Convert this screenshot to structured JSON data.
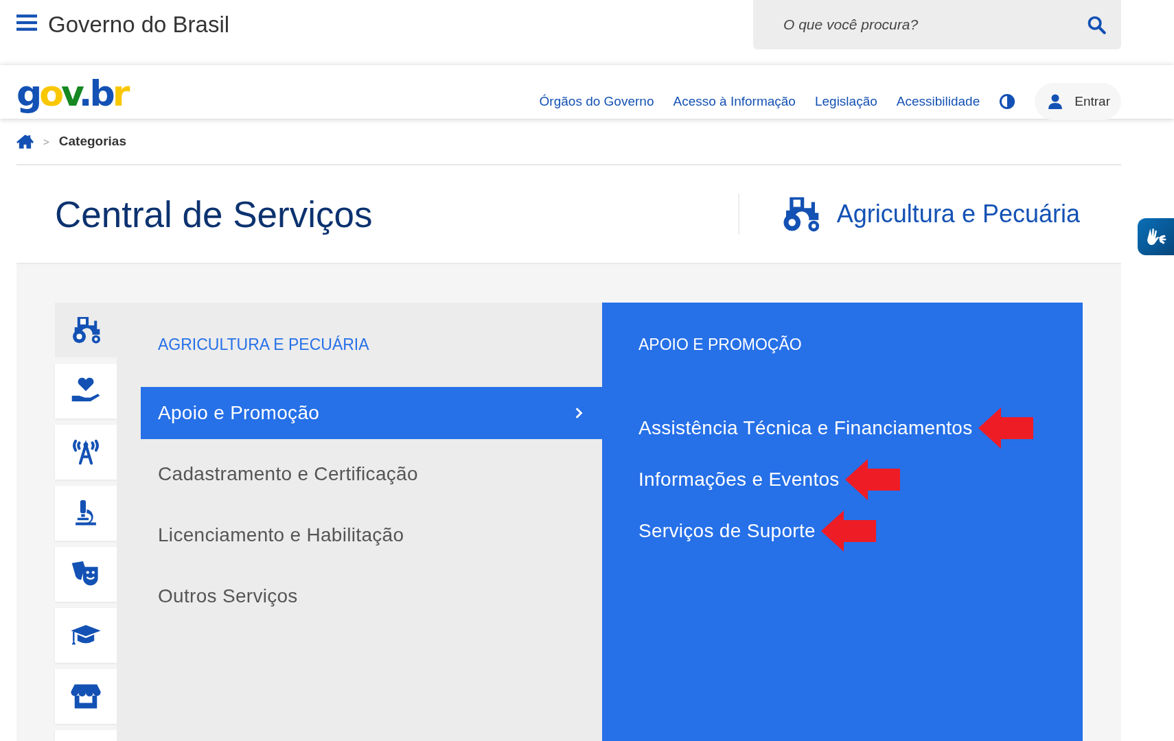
{
  "top_bar": {
    "title": "Governo do Brasil",
    "search": {
      "placeholder": "O que você procura?"
    }
  },
  "header": {
    "logo": "gov.br",
    "nav": [
      "Órgãos do Governo",
      "Acesso à Informação",
      "Legislação",
      "Acessibilidade"
    ],
    "login": "Entrar"
  },
  "breadcrumb": {
    "separator": ">",
    "items": [
      "Categorias"
    ]
  },
  "page": {
    "title": "Central de Serviços",
    "category": "Agricultura e Pecuária"
  },
  "category_icons": [
    {
      "kind": "tractor",
      "selected": true
    },
    {
      "kind": "heart-hand",
      "selected": false
    },
    {
      "kind": "antenna",
      "selected": false
    },
    {
      "kind": "microscope",
      "selected": false
    },
    {
      "kind": "masks",
      "selected": false
    },
    {
      "kind": "graduation-cap",
      "selected": false
    },
    {
      "kind": "store",
      "selected": false
    },
    {
      "kind": "blank",
      "selected": false
    }
  ],
  "subcategories": {
    "heading": "AGRICULTURA E PECUÁRIA",
    "items": [
      {
        "label": "Apoio e Promoção",
        "selected": true
      },
      {
        "label": "Cadastramento e Certificação",
        "selected": false
      },
      {
        "label": "Licenciamento e Habilitação",
        "selected": false
      },
      {
        "label": "Outros Serviços",
        "selected": false
      }
    ]
  },
  "services": {
    "heading": "APOIO E PROMOÇÃO",
    "items": [
      {
        "label": "Assistência Técnica e Financiamentos",
        "marked": true
      },
      {
        "label": "Informações e Eventos",
        "marked": true
      },
      {
        "label": "Serviços de Suporte",
        "marked": true
      }
    ]
  }
}
